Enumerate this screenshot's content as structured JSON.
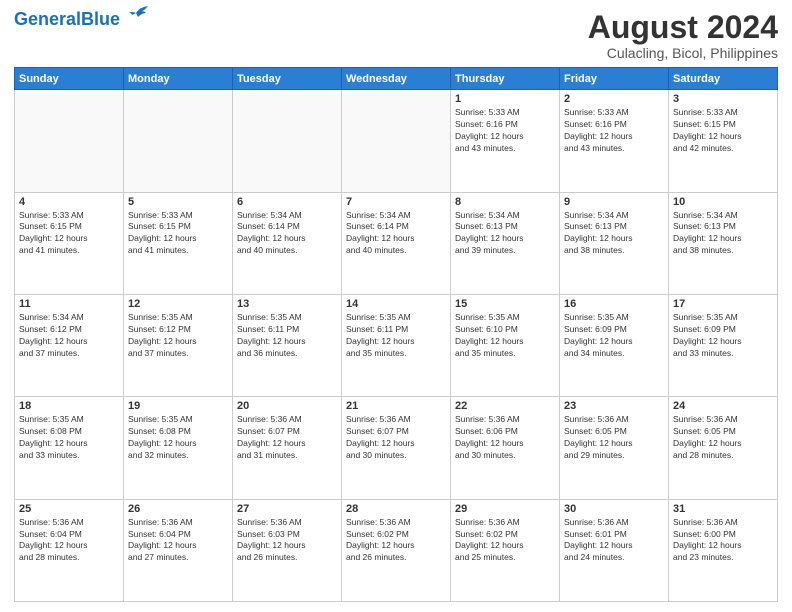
{
  "header": {
    "logo_general": "General",
    "logo_blue": "Blue",
    "main_title": "August 2024",
    "subtitle": "Culacling, Bicol, Philippines"
  },
  "weekdays": [
    "Sunday",
    "Monday",
    "Tuesday",
    "Wednesday",
    "Thursday",
    "Friday",
    "Saturday"
  ],
  "weeks": [
    [
      {
        "day": "",
        "info": ""
      },
      {
        "day": "",
        "info": ""
      },
      {
        "day": "",
        "info": ""
      },
      {
        "day": "",
        "info": ""
      },
      {
        "day": "1",
        "info": "Sunrise: 5:33 AM\nSunset: 6:16 PM\nDaylight: 12 hours\nand 43 minutes."
      },
      {
        "day": "2",
        "info": "Sunrise: 5:33 AM\nSunset: 6:16 PM\nDaylight: 12 hours\nand 43 minutes."
      },
      {
        "day": "3",
        "info": "Sunrise: 5:33 AM\nSunset: 6:15 PM\nDaylight: 12 hours\nand 42 minutes."
      }
    ],
    [
      {
        "day": "4",
        "info": "Sunrise: 5:33 AM\nSunset: 6:15 PM\nDaylight: 12 hours\nand 41 minutes."
      },
      {
        "day": "5",
        "info": "Sunrise: 5:33 AM\nSunset: 6:15 PM\nDaylight: 12 hours\nand 41 minutes."
      },
      {
        "day": "6",
        "info": "Sunrise: 5:34 AM\nSunset: 6:14 PM\nDaylight: 12 hours\nand 40 minutes."
      },
      {
        "day": "7",
        "info": "Sunrise: 5:34 AM\nSunset: 6:14 PM\nDaylight: 12 hours\nand 40 minutes."
      },
      {
        "day": "8",
        "info": "Sunrise: 5:34 AM\nSunset: 6:13 PM\nDaylight: 12 hours\nand 39 minutes."
      },
      {
        "day": "9",
        "info": "Sunrise: 5:34 AM\nSunset: 6:13 PM\nDaylight: 12 hours\nand 38 minutes."
      },
      {
        "day": "10",
        "info": "Sunrise: 5:34 AM\nSunset: 6:13 PM\nDaylight: 12 hours\nand 38 minutes."
      }
    ],
    [
      {
        "day": "11",
        "info": "Sunrise: 5:34 AM\nSunset: 6:12 PM\nDaylight: 12 hours\nand 37 minutes."
      },
      {
        "day": "12",
        "info": "Sunrise: 5:35 AM\nSunset: 6:12 PM\nDaylight: 12 hours\nand 37 minutes."
      },
      {
        "day": "13",
        "info": "Sunrise: 5:35 AM\nSunset: 6:11 PM\nDaylight: 12 hours\nand 36 minutes."
      },
      {
        "day": "14",
        "info": "Sunrise: 5:35 AM\nSunset: 6:11 PM\nDaylight: 12 hours\nand 35 minutes."
      },
      {
        "day": "15",
        "info": "Sunrise: 5:35 AM\nSunset: 6:10 PM\nDaylight: 12 hours\nand 35 minutes."
      },
      {
        "day": "16",
        "info": "Sunrise: 5:35 AM\nSunset: 6:09 PM\nDaylight: 12 hours\nand 34 minutes."
      },
      {
        "day": "17",
        "info": "Sunrise: 5:35 AM\nSunset: 6:09 PM\nDaylight: 12 hours\nand 33 minutes."
      }
    ],
    [
      {
        "day": "18",
        "info": "Sunrise: 5:35 AM\nSunset: 6:08 PM\nDaylight: 12 hours\nand 33 minutes."
      },
      {
        "day": "19",
        "info": "Sunrise: 5:35 AM\nSunset: 6:08 PM\nDaylight: 12 hours\nand 32 minutes."
      },
      {
        "day": "20",
        "info": "Sunrise: 5:36 AM\nSunset: 6:07 PM\nDaylight: 12 hours\nand 31 minutes."
      },
      {
        "day": "21",
        "info": "Sunrise: 5:36 AM\nSunset: 6:07 PM\nDaylight: 12 hours\nand 30 minutes."
      },
      {
        "day": "22",
        "info": "Sunrise: 5:36 AM\nSunset: 6:06 PM\nDaylight: 12 hours\nand 30 minutes."
      },
      {
        "day": "23",
        "info": "Sunrise: 5:36 AM\nSunset: 6:05 PM\nDaylight: 12 hours\nand 29 minutes."
      },
      {
        "day": "24",
        "info": "Sunrise: 5:36 AM\nSunset: 6:05 PM\nDaylight: 12 hours\nand 28 minutes."
      }
    ],
    [
      {
        "day": "25",
        "info": "Sunrise: 5:36 AM\nSunset: 6:04 PM\nDaylight: 12 hours\nand 28 minutes."
      },
      {
        "day": "26",
        "info": "Sunrise: 5:36 AM\nSunset: 6:04 PM\nDaylight: 12 hours\nand 27 minutes."
      },
      {
        "day": "27",
        "info": "Sunrise: 5:36 AM\nSunset: 6:03 PM\nDaylight: 12 hours\nand 26 minutes."
      },
      {
        "day": "28",
        "info": "Sunrise: 5:36 AM\nSunset: 6:02 PM\nDaylight: 12 hours\nand 26 minutes."
      },
      {
        "day": "29",
        "info": "Sunrise: 5:36 AM\nSunset: 6:02 PM\nDaylight: 12 hours\nand 25 minutes."
      },
      {
        "day": "30",
        "info": "Sunrise: 5:36 AM\nSunset: 6:01 PM\nDaylight: 12 hours\nand 24 minutes."
      },
      {
        "day": "31",
        "info": "Sunrise: 5:36 AM\nSunset: 6:00 PM\nDaylight: 12 hours\nand 23 minutes."
      }
    ]
  ]
}
